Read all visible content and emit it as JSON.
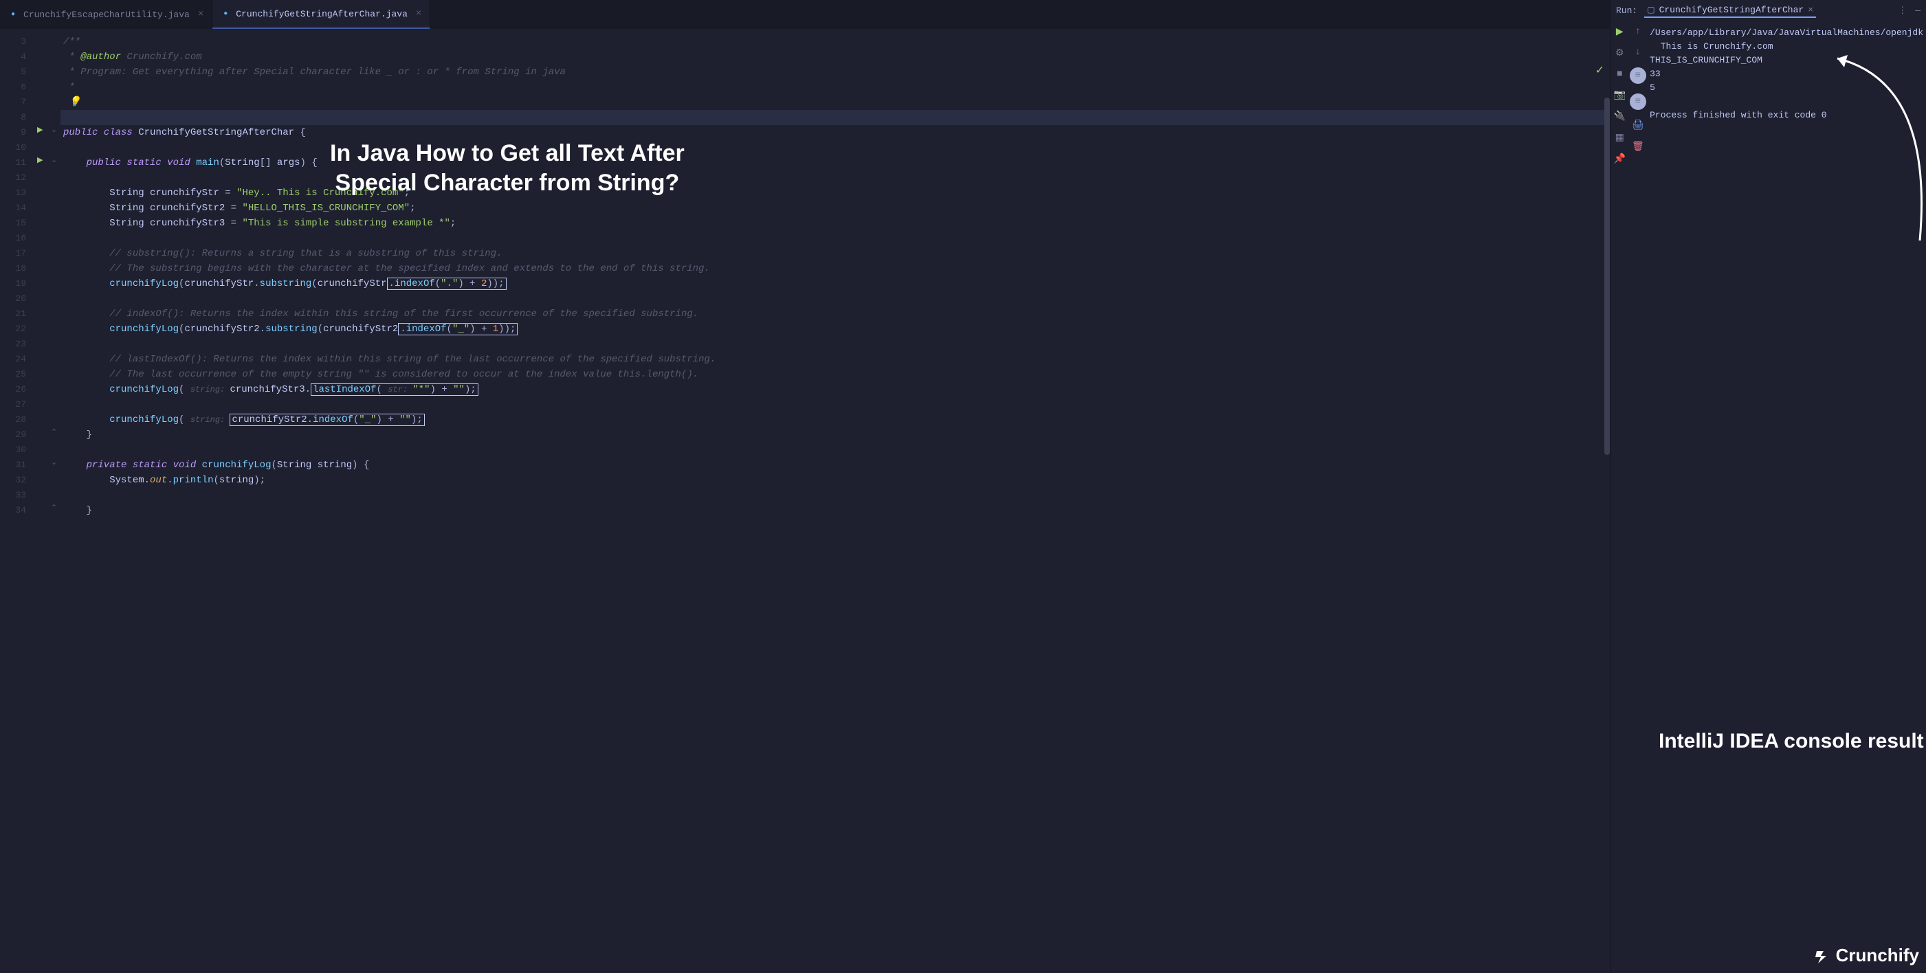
{
  "tabs": [
    {
      "name": "CrunchifyEscapeCharUtility.java",
      "active": false
    },
    {
      "name": "CrunchifyGetStringAfterChar.java",
      "active": true
    }
  ],
  "lines": [
    "3",
    "4",
    "5",
    "6",
    "7",
    "8",
    "9",
    "10",
    "11",
    "12",
    "13",
    "14",
    "15",
    "16",
    "17",
    "18",
    "19",
    "20",
    "21",
    "22",
    "23",
    "24",
    "25",
    "26",
    "27",
    "28",
    "29",
    "30",
    "31",
    "32",
    "33",
    "34"
  ],
  "code": {
    "l3": "/**",
    "l4a": " * ",
    "l4b": "@author",
    "l4c": " Crunchify.com",
    "l5": " * Program: Get everything after Special character like _ or : or * from String in java",
    "l6": " *",
    "l7": " 💡",
    "l8": "",
    "l9a": "public",
    "l9b": " class ",
    "l9c": "CrunchifyGetStringAfterChar",
    "l9d": " {",
    "l11a": "    public static ",
    "l11b": "void",
    "l11c": " ",
    "l11d": "main",
    "l11e": "(",
    "l11f": "String",
    "l11g": "[] ",
    "l11h": "args",
    "l11i": ") {",
    "l13a": "        String ",
    "l13b": "crunchifyStr",
    "l13c": " = ",
    "l13d": "\"Hey.. This is Crunchify.com\"",
    "l13e": ";",
    "l14a": "        String ",
    "l14b": "crunchifyStr2",
    "l14c": " = ",
    "l14d": "\"HELLO_THIS_IS_CRUNCHIFY_COM\"",
    "l14e": ";",
    "l15a": "        String ",
    "l15b": "crunchifyStr3",
    "l15c": " = ",
    "l15d": "\"This is simple substring example *\"",
    "l15e": ";",
    "l17": "        // substring(): Returns a string that is a substring of this string.",
    "l18": "        // The substring begins with the character at the specified index and extends to the end of this string.",
    "l19a": "        crunchifyLog",
    "l19b": "(",
    "l19c": "crunchifyStr",
    "l19d": ".",
    "l19e": "substring",
    "l19f": "(",
    "l19g": "crunchifyStr",
    "l19h": ".",
    "l19i": "indexOf",
    "l19j": "(",
    "l19k": "\".\"",
    "l19l": ") + ",
    "l19m": "2",
    "l19n": "));",
    "l21": "        // indexOf(): Returns the index within this string of the first occurrence of the specified substring.",
    "l22a": "        crunchifyLog",
    "l22b": "(",
    "l22c": "crunchifyStr2",
    "l22d": ".",
    "l22e": "substring",
    "l22f": "(",
    "l22g": "crunchifyStr2",
    "l22h": ".",
    "l22i": "indexOf",
    "l22j": "(",
    "l22k": "\"_\"",
    "l22l": ") + ",
    "l22m": "1",
    "l22n": "));",
    "l24": "        // lastIndexOf(): Returns the index within this string of the last occurrence of the specified substring.",
    "l25": "        // The last occurrence of the empty string \"\" is considered to occur at the index value this.length().",
    "l26a": "        crunchifyLog",
    "l26b": "( ",
    "l26hint1": "string: ",
    "l26c": "crunchifyStr3",
    "l26d": ".",
    "l26e": "lastIndexOf",
    "l26f": "( ",
    "l26hint2": "str: ",
    "l26g": "\"*\"",
    "l26h": ") + ",
    "l26i": "\"\"",
    "l26j": ");",
    "l28a": "        crunchifyLog",
    "l28b": "( ",
    "l28hint": "string: ",
    "l28c": "crunchifyStr2",
    "l28d": ".",
    "l28e": "indexOf",
    "l28f": "(",
    "l28g": "\"_\"",
    "l28h": ") + ",
    "l28i": "\"\"",
    "l28j": ");",
    "l29": "    }",
    "l31a": "    private static ",
    "l31b": "void",
    "l31c": " ",
    "l31d": "crunchifyLog",
    "l31e": "(",
    "l31f": "String",
    "l31g": " ",
    "l31h": "string",
    "l31i": ") {",
    "l32a": "        System.",
    "l32b": "out",
    "l32c": ".",
    "l32d": "println",
    "l32e": "(",
    "l32f": "string",
    "l32g": ");",
    "l34": "    }"
  },
  "overlay": "In Java How to Get all Text After\nSpecial Character from String?",
  "run": {
    "label": "Run:",
    "tab": "CrunchifyGetStringAfterChar",
    "output": [
      "/Users/app/Library/Java/JavaVirtualMachines/openjdk",
      "  This is Crunchify.com",
      "THIS_IS_CRUNCHIFY_COM",
      "33",
      "5",
      "",
      "Process finished with exit code 0"
    ]
  },
  "annotation": "IntelliJ IDEA console result",
  "logo": "Crunchify"
}
